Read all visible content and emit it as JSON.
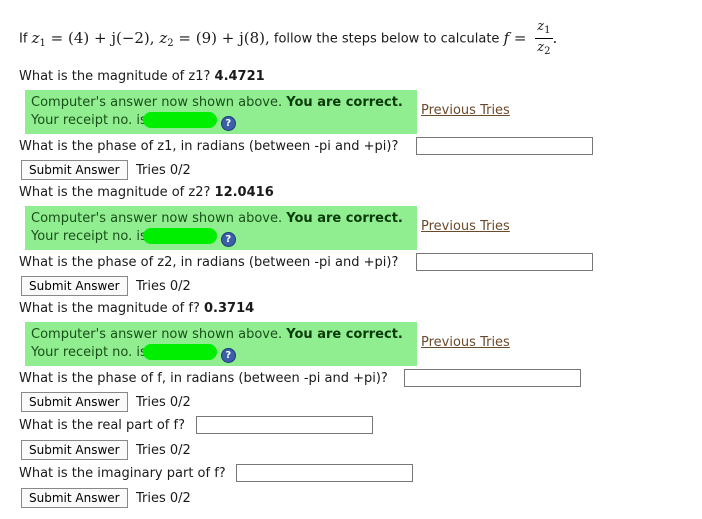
{
  "problem": {
    "intro": "If",
    "z1_def": "= (4) + j(−2),",
    "z2_def": "= (9) + j(8),",
    "instruction": "follow the steps below to calculate",
    "f_var": "f",
    "equals": "=",
    "z1_var": "z",
    "z2_var": "z",
    "sub1": "1",
    "sub2": "2",
    "period": "."
  },
  "questions": [
    {
      "label": "What is the magnitude of z1?",
      "value": "4.4721",
      "answered": true
    },
    {
      "label": "What is the phase of z1, in radians (between -pi and +pi)?",
      "answered": false,
      "button": "Submit Answer",
      "tries": "Tries 0/2"
    },
    {
      "label": "What is the magnitude of z2?",
      "value": "12.0416",
      "answered": true
    },
    {
      "label": "What is the phase of z2, in radians (between -pi and +pi)?",
      "answered": false,
      "button": "Submit Answer",
      "tries": "Tries 0/2"
    },
    {
      "label": "What is the magnitude of f?",
      "value": "0.3714",
      "answered": true
    },
    {
      "label": "What is the phase of f, in radians (between -pi and +pi)?",
      "answered": false,
      "button": "Submit Answer",
      "tries": "Tries 0/2"
    },
    {
      "label": "What is the real part of f?",
      "answered": false,
      "button": "Submit Answer",
      "tries": "Tries 0/2"
    },
    {
      "label": "What is the imaginary part of f?",
      "answered": false,
      "button": "Submit Answer",
      "tries": "Tries 0/2"
    }
  ],
  "feedback": {
    "shown": "Computer's answer now shown above.",
    "correct": "You are correct.",
    "receipt": "Your receipt no. is",
    "help": "?",
    "previous_tries": "Previous Tries"
  },
  "colors": {
    "correct_bg": "#90ee90",
    "redaction": "#00ee00",
    "link": "#6b4a2a"
  }
}
